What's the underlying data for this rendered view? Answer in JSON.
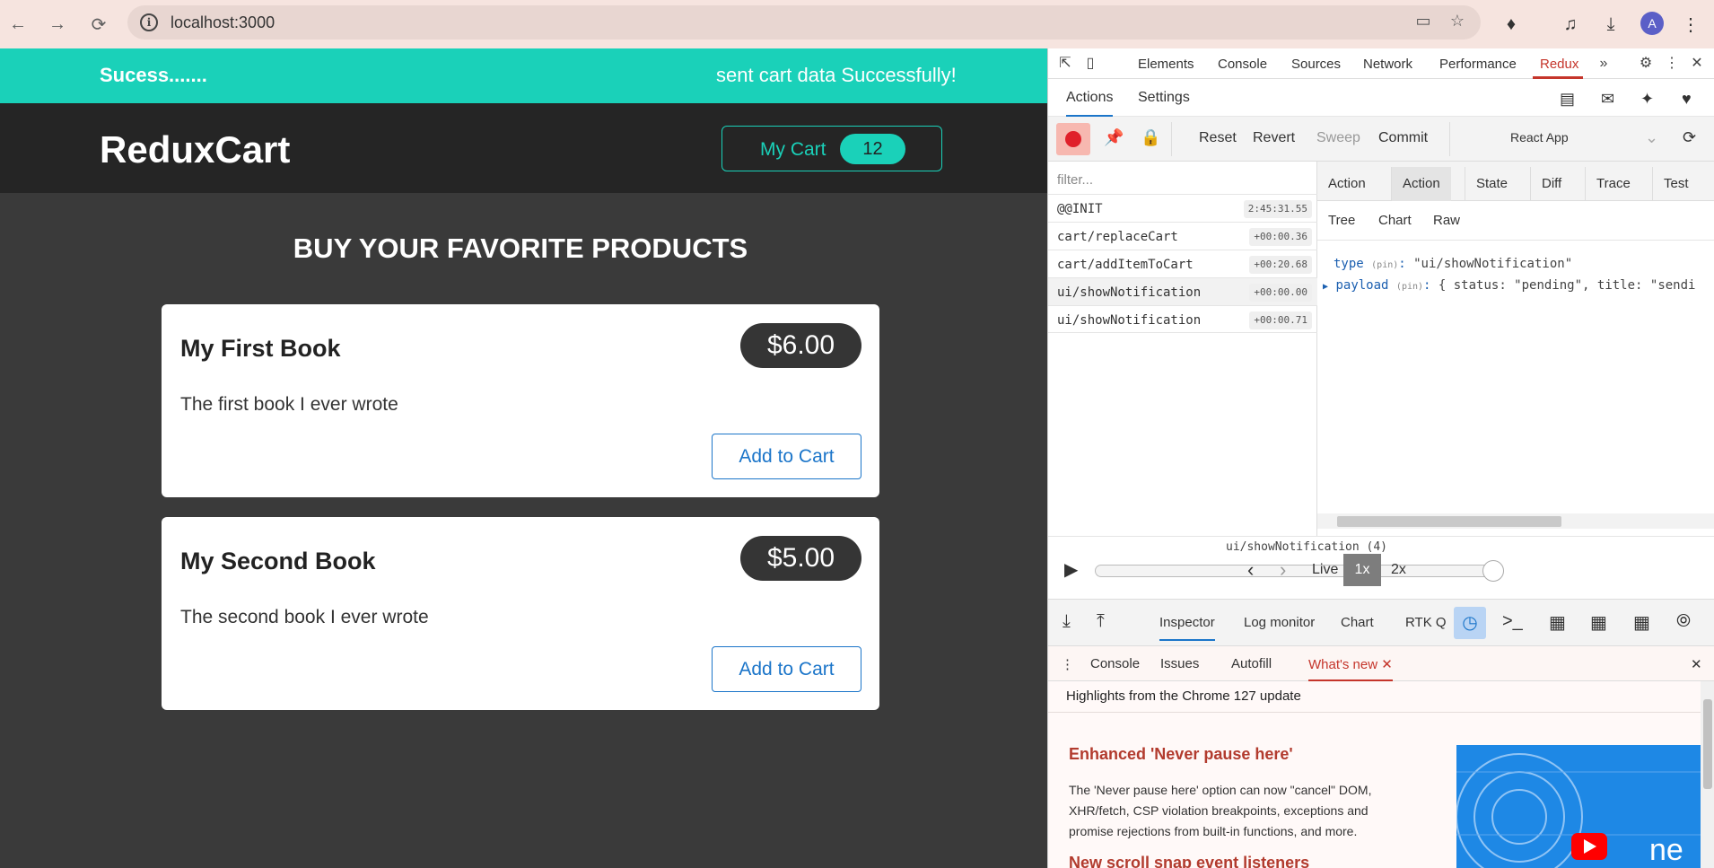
{
  "browser": {
    "url": "localhost:3000",
    "avatar_letter": "A"
  },
  "app": {
    "notification": {
      "title": "Sucess.......",
      "message": "sent cart data Successfully!"
    },
    "logo": "ReduxCart",
    "cart": {
      "label": "My Cart",
      "count": "12"
    },
    "heading": "BUY YOUR FAVORITE PRODUCTS",
    "products": [
      {
        "title": "My First Book",
        "price": "$6.00",
        "description": "The first book I ever wrote",
        "button": "Add to Cart"
      },
      {
        "title": "My Second Book",
        "price": "$5.00",
        "description": "The second book I ever wrote",
        "button": "Add to Cart"
      }
    ],
    "accent_color": "#1ad1b9"
  },
  "devtools": {
    "tabs": [
      "Elements",
      "Console",
      "Sources",
      "Network",
      "Performance",
      "Redux"
    ],
    "active_tab": "Redux",
    "redux": {
      "top_tabs": [
        "Actions",
        "Settings"
      ],
      "toolbar": {
        "reset": "Reset",
        "revert": "Revert",
        "sweep": "Sweep",
        "commit": "Commit",
        "app_select": "React App"
      },
      "filter_placeholder": "filter...",
      "actions": [
        {
          "name": "@@INIT",
          "time": "2:45:31.55"
        },
        {
          "name": "cart/replaceCart",
          "time": "+00:00.36"
        },
        {
          "name": "cart/addItemToCart",
          "time": "+00:20.68"
        },
        {
          "name": "ui/showNotification",
          "time": "+00:00.00"
        },
        {
          "name": "ui/showNotification",
          "time": "+00:00.71"
        }
      ],
      "right_tabs": [
        "Action",
        "Action",
        "State",
        "Diff",
        "Trace",
        "Test"
      ],
      "sub_tabs": [
        "Tree",
        "Chart",
        "Raw"
      ],
      "tree": {
        "type_key": "type",
        "pin": "(pin)",
        "type_value": "\"ui/showNotification\"",
        "payload_key": "payload",
        "payload_value": "{ status: \"pending\", title: \"sendi"
      },
      "slider": {
        "caption": "ui/showNotification (4)",
        "live": "Live",
        "speed_1x": "1x",
        "speed_2x": "2x",
        "position": 1.0
      },
      "bottom_tabs": [
        "Inspector",
        "Log monitor",
        "Chart",
        "RTK Q"
      ]
    },
    "drawer": {
      "tabs": [
        "Console",
        "Issues",
        "Autofill",
        "What's new"
      ],
      "highlights": "Highlights from the Chrome 127 update",
      "feature1_title": "Enhanced 'Never pause here'",
      "feature1_text": "The 'Never pause here' option can now \"cancel\" DOM, XHR/fetch, CSP violation breakpoints, exceptions and promise rejections from built-in functions, and more.",
      "feature2_title": "New scroll snap event listeners",
      "video_text": "ne"
    }
  }
}
